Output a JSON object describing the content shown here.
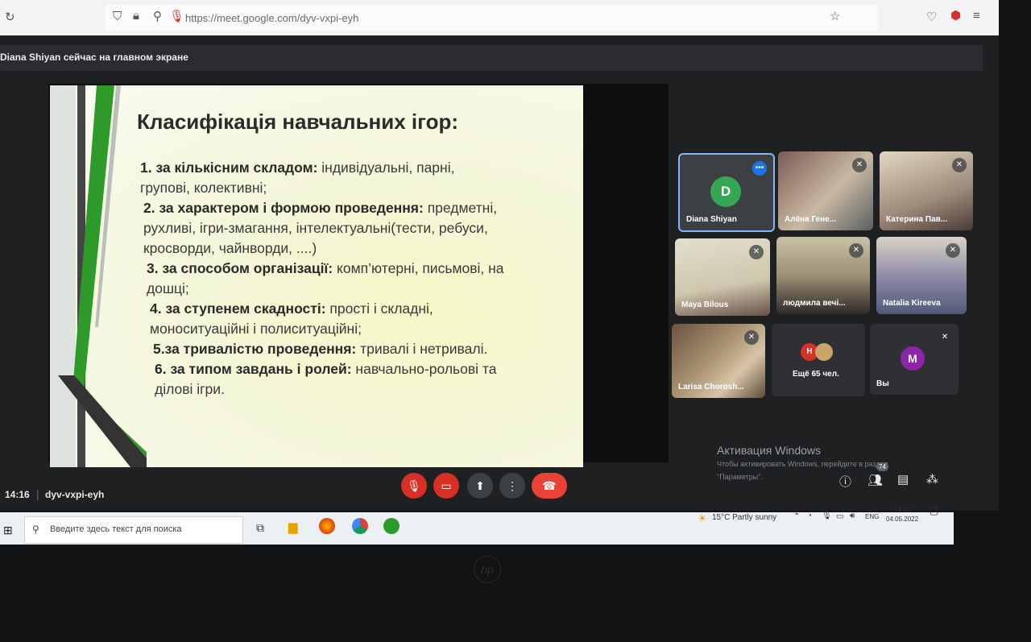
{
  "browser": {
    "url": "https://meet.google.com/dyv-vxpi-eyh",
    "icons": [
      "reload-icon",
      "shield-icon",
      "lock-icon",
      "permissions-icon",
      "mic-active-icon",
      "star-icon",
      "pocket-icon",
      "extension-icon",
      "menu-icon"
    ]
  },
  "meet": {
    "presenting_notice": "Diana Shiyan сейчас на главном экране",
    "time": "14:16",
    "meeting_code": "dyv-vxpi-eyh",
    "participants_count": "74",
    "activation_title": "Активация Windows",
    "activation_line1": "Чтобы активировать Windows, перейдите в раздел",
    "activation_line2": "\"Параметры\"."
  },
  "slide": {
    "title": "Класифікація навчальних ігор:",
    "items": [
      {
        "bold": "1. за кількісним складом:",
        "text": " індивідуальні, парні,"
      },
      {
        "bold": "",
        "text": "групові, колективні;"
      },
      {
        "bold": "2. за характером і формою проведення:",
        "text": " предметні,"
      },
      {
        "bold": "",
        "text": "рухливі, ігри-змагання, інтелектуальні(тести, ребуси,"
      },
      {
        "bold": "",
        "text": "кросворди, чайнворди, ....)"
      },
      {
        "bold": "3. за способом організації:",
        "text": " комп’ютерні, письмові, на"
      },
      {
        "bold": "",
        "text": "дошці;"
      },
      {
        "bold": "4. за ступенем скадності:",
        "text": " прості і складні,"
      },
      {
        "bold": "",
        "text": "моноситуаційні і полиситуаційні;"
      },
      {
        "bold": "5.за тривалістю проведення:",
        "text": " тривалі і нетривалі."
      },
      {
        "bold": "6. за типом завдань і ролей:",
        "text": " навчально-рольові та"
      },
      {
        "bold": "",
        "text": "ділові ігри."
      }
    ]
  },
  "tiles": [
    {
      "name": "Diana Shiyan",
      "initial": "D",
      "color": "#34a853"
    },
    {
      "name": "Алёна Гене..."
    },
    {
      "name": "Катерина Пав..."
    },
    {
      "name": "Maya Bilous"
    },
    {
      "name": "людмила вечі..."
    },
    {
      "name": "Natalia Kireeva"
    },
    {
      "name": "Larisa Chorosh..."
    },
    {
      "name": "Ещё 65 чел.",
      "initial": "Н"
    },
    {
      "name": "Вы",
      "initial": "M",
      "color": "#8e24aa"
    }
  ],
  "taskbar": {
    "search_placeholder": "Введите здесь текст для поиска",
    "weather": "15°C  Partly sunny",
    "lang": "ENG",
    "clock_time": "14:16",
    "clock_date": "04.05.2022"
  }
}
